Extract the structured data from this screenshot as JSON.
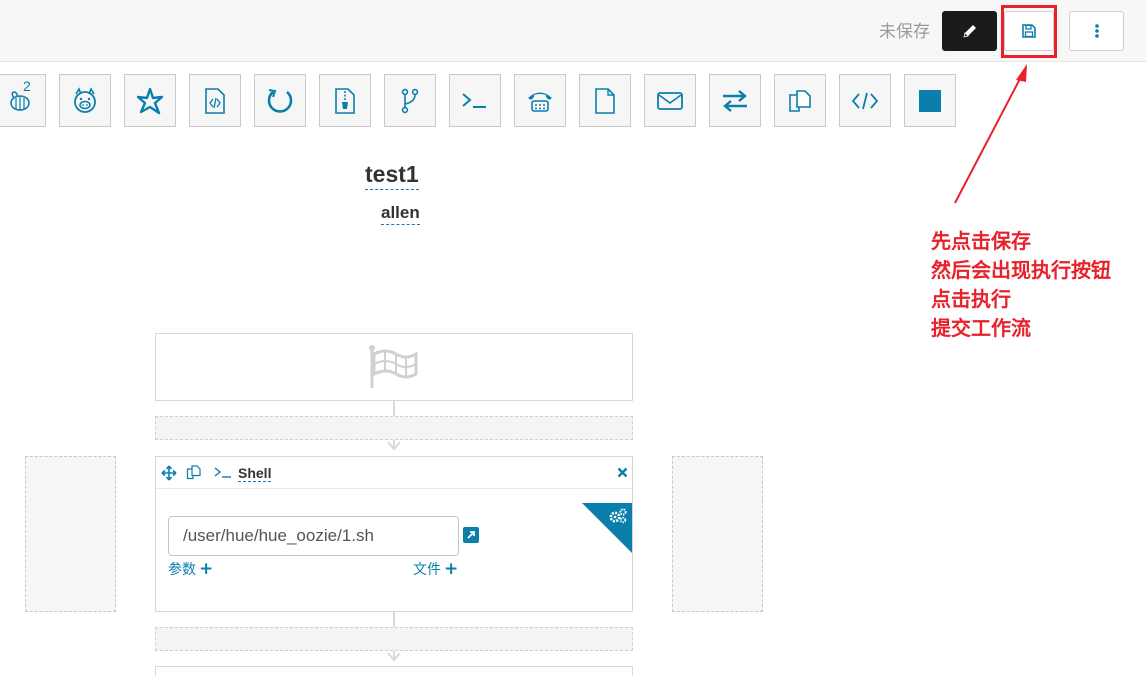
{
  "header": {
    "status": "未保存",
    "edit_icon": "pencil-icon",
    "save_icon": "floppy-disk-icon",
    "more_icon": "vertical-ellipsis-icon"
  },
  "palette": {
    "items": [
      {
        "name": "hive",
        "icon": "bee-icon",
        "badge": "2"
      },
      {
        "name": "pig",
        "icon": "pig-icon"
      },
      {
        "name": "spark",
        "icon": "star-icon"
      },
      {
        "name": "java",
        "icon": "java-file-icon"
      },
      {
        "name": "sqoop",
        "icon": "cycle-icon"
      },
      {
        "name": "mapreduce",
        "icon": "zip-file-icon"
      },
      {
        "name": "subworkflow",
        "icon": "branch-icon"
      },
      {
        "name": "shell",
        "icon": "terminal-icon"
      },
      {
        "name": "ssh",
        "icon": "phone-icon"
      },
      {
        "name": "hdfs-fs",
        "icon": "file-icon"
      },
      {
        "name": "email",
        "icon": "envelope-icon"
      },
      {
        "name": "streaming",
        "icon": "exchange-icon"
      },
      {
        "name": "distcp",
        "icon": "copy-icon"
      },
      {
        "name": "generic",
        "icon": "code-icon"
      },
      {
        "name": "stop",
        "icon": "square-icon"
      }
    ]
  },
  "workflow": {
    "name": "test1",
    "user": "allen"
  },
  "canvas": {
    "start_icon": "flag-icon",
    "node": {
      "type": "Shell",
      "script_path": "/user/hue/hue_oozie/1.sh",
      "params_label": "参数",
      "files_label": "文件",
      "move_icon": "move-icon",
      "copy_icon": "copy-icon",
      "shell_icon": "terminal-icon",
      "close_icon": "close-icon",
      "settings_icon": "cogs-icon",
      "link_icon": "external-link-icon"
    }
  },
  "annotation": {
    "color": "#e8212a",
    "lines": [
      "先点击保存",
      "然后会出现执行按钮",
      "点击执行",
      "提交工作流"
    ]
  },
  "colors": {
    "accent": "#0b7fab",
    "annotation_red": "#e8212a",
    "dark_button": "#1b1b1b"
  }
}
